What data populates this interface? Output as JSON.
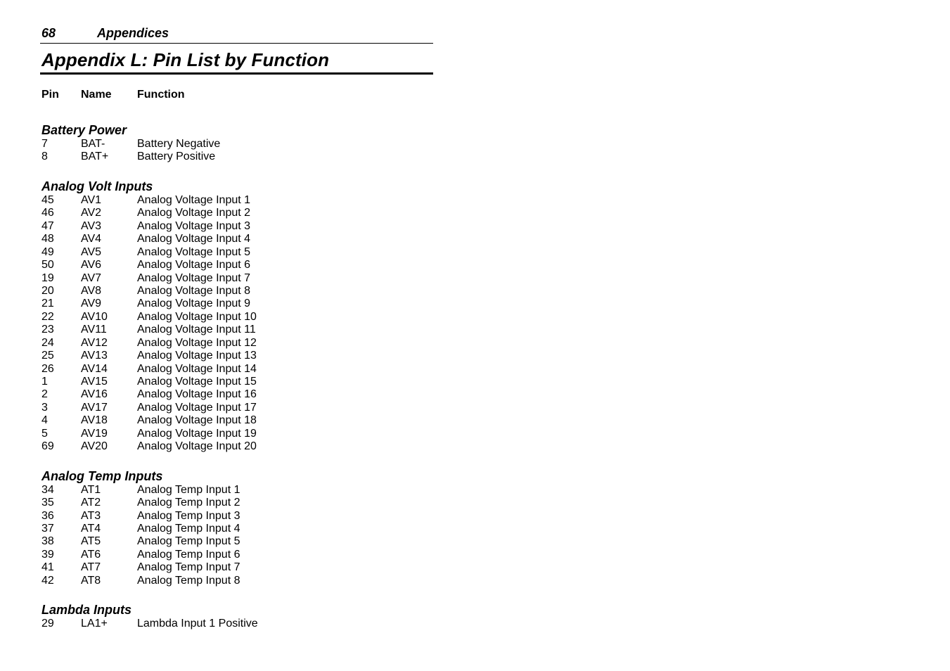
{
  "header": {
    "page_number": "68",
    "running_title": "Appendices"
  },
  "title": "Appendix L: Pin List by Function",
  "columns": {
    "pin": "Pin",
    "name": "Name",
    "function": "Function"
  },
  "sections": [
    {
      "title": "Battery Power",
      "rows": [
        {
          "pin": "7",
          "name": "BAT-",
          "function": "Battery Negative"
        },
        {
          "pin": "8",
          "name": "BAT+",
          "function": "Battery Positive"
        }
      ]
    },
    {
      "title": "Analog Volt Inputs",
      "rows": [
        {
          "pin": "45",
          "name": "AV1",
          "function": "Analog Voltage Input 1"
        },
        {
          "pin": "46",
          "name": "AV2",
          "function": "Analog Voltage Input 2"
        },
        {
          "pin": "47",
          "name": "AV3",
          "function": "Analog Voltage Input 3"
        },
        {
          "pin": "48",
          "name": "AV4",
          "function": "Analog Voltage Input 4"
        },
        {
          "pin": "49",
          "name": "AV5",
          "function": "Analog Voltage Input 5"
        },
        {
          "pin": "50",
          "name": "AV6",
          "function": "Analog Voltage Input 6"
        },
        {
          "pin": "19",
          "name": "AV7",
          "function": "Analog Voltage Input 7"
        },
        {
          "pin": "20",
          "name": "AV8",
          "function": "Analog Voltage Input 8"
        },
        {
          "pin": "21",
          "name": "AV9",
          "function": "Analog Voltage Input 9"
        },
        {
          "pin": "22",
          "name": "AV10",
          "function": "Analog Voltage Input 10"
        },
        {
          "pin": "23",
          "name": "AV11",
          "function": "Analog Voltage Input 11"
        },
        {
          "pin": "24",
          "name": "AV12",
          "function": "Analog Voltage Input 12"
        },
        {
          "pin": "25",
          "name": "AV13",
          "function": "Analog Voltage Input 13"
        },
        {
          "pin": "26",
          "name": "AV14",
          "function": "Analog Voltage Input 14"
        },
        {
          "pin": "1",
          "name": "AV15",
          "function": "Analog Voltage Input 15"
        },
        {
          "pin": "2",
          "name": "AV16",
          "function": "Analog Voltage Input 16"
        },
        {
          "pin": "3",
          "name": "AV17",
          "function": "Analog Voltage Input 17"
        },
        {
          "pin": "4",
          "name": "AV18",
          "function": "Analog Voltage Input 18"
        },
        {
          "pin": "5",
          "name": "AV19",
          "function": "Analog Voltage Input 19"
        },
        {
          "pin": "69",
          "name": "AV20",
          "function": "Analog Voltage Input 20"
        }
      ]
    },
    {
      "title": "Analog Temp Inputs",
      "rows": [
        {
          "pin": "34",
          "name": "AT1",
          "function": "Analog Temp Input 1"
        },
        {
          "pin": "35",
          "name": "AT2",
          "function": "Analog Temp Input 2"
        },
        {
          "pin": "36",
          "name": "AT3",
          "function": "Analog Temp Input 3"
        },
        {
          "pin": "37",
          "name": "AT4",
          "function": "Analog Temp Input 4"
        },
        {
          "pin": "38",
          "name": "AT5",
          "function": "Analog Temp Input 5"
        },
        {
          "pin": "39",
          "name": "AT6",
          "function": "Analog Temp Input 6"
        },
        {
          "pin": "41",
          "name": "AT7",
          "function": "Analog Temp Input 7"
        },
        {
          "pin": "42",
          "name": "AT8",
          "function": "Analog Temp Input 8"
        }
      ]
    },
    {
      "title": "Lambda Inputs",
      "rows": [
        {
          "pin": "29",
          "name": "LA1+",
          "function": "Lambda Input 1 Positive"
        }
      ]
    }
  ]
}
